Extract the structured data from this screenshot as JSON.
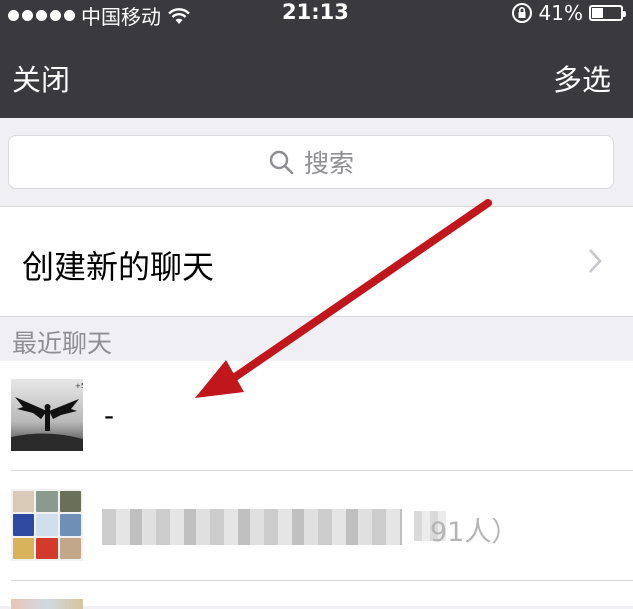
{
  "status_bar": {
    "carrier": "中国移动",
    "time": "21:13",
    "battery": "41%",
    "battery_level": 0.41
  },
  "nav": {
    "close_label": "关闭",
    "multi_select_label": "多选"
  },
  "search": {
    "placeholder": "搜索"
  },
  "create_chat": {
    "label": "创建新的聊天"
  },
  "recent": {
    "header": "最近聊天",
    "chats": [
      {
        "name": "-"
      },
      {
        "name_visible_suffix": "91人）"
      }
    ]
  },
  "colors": {
    "nav_bg": "#3a393e",
    "arrow": "#c0161c",
    "page_bg": "#efeff4"
  }
}
